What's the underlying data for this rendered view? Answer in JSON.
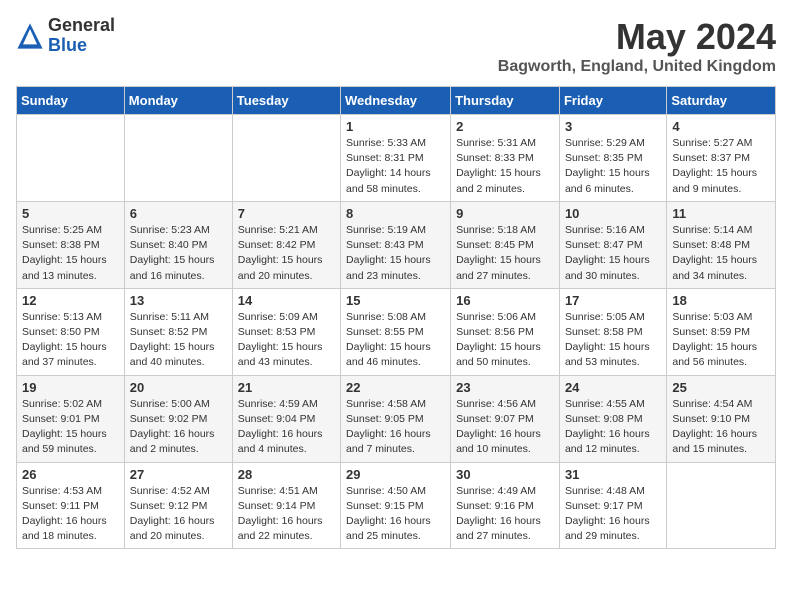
{
  "logo": {
    "general": "General",
    "blue": "Blue"
  },
  "title": "May 2024",
  "location": "Bagworth, England, United Kingdom",
  "headers": [
    "Sunday",
    "Monday",
    "Tuesday",
    "Wednesday",
    "Thursday",
    "Friday",
    "Saturday"
  ],
  "weeks": [
    [
      {
        "day": "",
        "info": ""
      },
      {
        "day": "",
        "info": ""
      },
      {
        "day": "",
        "info": ""
      },
      {
        "day": "1",
        "info": "Sunrise: 5:33 AM\nSunset: 8:31 PM\nDaylight: 14 hours\nand 58 minutes."
      },
      {
        "day": "2",
        "info": "Sunrise: 5:31 AM\nSunset: 8:33 PM\nDaylight: 15 hours\nand 2 minutes."
      },
      {
        "day": "3",
        "info": "Sunrise: 5:29 AM\nSunset: 8:35 PM\nDaylight: 15 hours\nand 6 minutes."
      },
      {
        "day": "4",
        "info": "Sunrise: 5:27 AM\nSunset: 8:37 PM\nDaylight: 15 hours\nand 9 minutes."
      }
    ],
    [
      {
        "day": "5",
        "info": "Sunrise: 5:25 AM\nSunset: 8:38 PM\nDaylight: 15 hours\nand 13 minutes."
      },
      {
        "day": "6",
        "info": "Sunrise: 5:23 AM\nSunset: 8:40 PM\nDaylight: 15 hours\nand 16 minutes."
      },
      {
        "day": "7",
        "info": "Sunrise: 5:21 AM\nSunset: 8:42 PM\nDaylight: 15 hours\nand 20 minutes."
      },
      {
        "day": "8",
        "info": "Sunrise: 5:19 AM\nSunset: 8:43 PM\nDaylight: 15 hours\nand 23 minutes."
      },
      {
        "day": "9",
        "info": "Sunrise: 5:18 AM\nSunset: 8:45 PM\nDaylight: 15 hours\nand 27 minutes."
      },
      {
        "day": "10",
        "info": "Sunrise: 5:16 AM\nSunset: 8:47 PM\nDaylight: 15 hours\nand 30 minutes."
      },
      {
        "day": "11",
        "info": "Sunrise: 5:14 AM\nSunset: 8:48 PM\nDaylight: 15 hours\nand 34 minutes."
      }
    ],
    [
      {
        "day": "12",
        "info": "Sunrise: 5:13 AM\nSunset: 8:50 PM\nDaylight: 15 hours\nand 37 minutes."
      },
      {
        "day": "13",
        "info": "Sunrise: 5:11 AM\nSunset: 8:52 PM\nDaylight: 15 hours\nand 40 minutes."
      },
      {
        "day": "14",
        "info": "Sunrise: 5:09 AM\nSunset: 8:53 PM\nDaylight: 15 hours\nand 43 minutes."
      },
      {
        "day": "15",
        "info": "Sunrise: 5:08 AM\nSunset: 8:55 PM\nDaylight: 15 hours\nand 46 minutes."
      },
      {
        "day": "16",
        "info": "Sunrise: 5:06 AM\nSunset: 8:56 PM\nDaylight: 15 hours\nand 50 minutes."
      },
      {
        "day": "17",
        "info": "Sunrise: 5:05 AM\nSunset: 8:58 PM\nDaylight: 15 hours\nand 53 minutes."
      },
      {
        "day": "18",
        "info": "Sunrise: 5:03 AM\nSunset: 8:59 PM\nDaylight: 15 hours\nand 56 minutes."
      }
    ],
    [
      {
        "day": "19",
        "info": "Sunrise: 5:02 AM\nSunset: 9:01 PM\nDaylight: 15 hours\nand 59 minutes."
      },
      {
        "day": "20",
        "info": "Sunrise: 5:00 AM\nSunset: 9:02 PM\nDaylight: 16 hours\nand 2 minutes."
      },
      {
        "day": "21",
        "info": "Sunrise: 4:59 AM\nSunset: 9:04 PM\nDaylight: 16 hours\nand 4 minutes."
      },
      {
        "day": "22",
        "info": "Sunrise: 4:58 AM\nSunset: 9:05 PM\nDaylight: 16 hours\nand 7 minutes."
      },
      {
        "day": "23",
        "info": "Sunrise: 4:56 AM\nSunset: 9:07 PM\nDaylight: 16 hours\nand 10 minutes."
      },
      {
        "day": "24",
        "info": "Sunrise: 4:55 AM\nSunset: 9:08 PM\nDaylight: 16 hours\nand 12 minutes."
      },
      {
        "day": "25",
        "info": "Sunrise: 4:54 AM\nSunset: 9:10 PM\nDaylight: 16 hours\nand 15 minutes."
      }
    ],
    [
      {
        "day": "26",
        "info": "Sunrise: 4:53 AM\nSunset: 9:11 PM\nDaylight: 16 hours\nand 18 minutes."
      },
      {
        "day": "27",
        "info": "Sunrise: 4:52 AM\nSunset: 9:12 PM\nDaylight: 16 hours\nand 20 minutes."
      },
      {
        "day": "28",
        "info": "Sunrise: 4:51 AM\nSunset: 9:14 PM\nDaylight: 16 hours\nand 22 minutes."
      },
      {
        "day": "29",
        "info": "Sunrise: 4:50 AM\nSunset: 9:15 PM\nDaylight: 16 hours\nand 25 minutes."
      },
      {
        "day": "30",
        "info": "Sunrise: 4:49 AM\nSunset: 9:16 PM\nDaylight: 16 hours\nand 27 minutes."
      },
      {
        "day": "31",
        "info": "Sunrise: 4:48 AM\nSunset: 9:17 PM\nDaylight: 16 hours\nand 29 minutes."
      },
      {
        "day": "",
        "info": ""
      }
    ]
  ]
}
